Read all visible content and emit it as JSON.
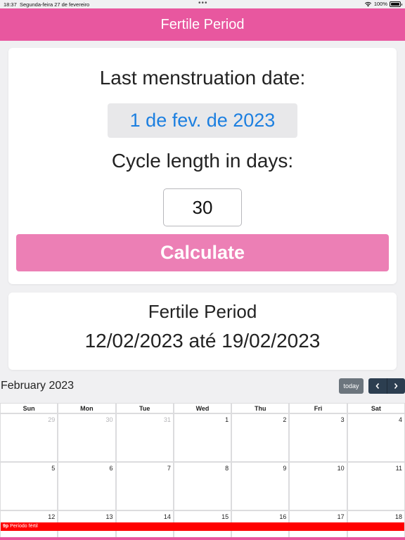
{
  "status_bar": {
    "time": "18:37",
    "date": "Segunda-feira 27 de fevereiro",
    "dots": "•••",
    "battery": "100%"
  },
  "header": {
    "title": "Fertile Period"
  },
  "form": {
    "last_menstruation_label": "Last menstruation date:",
    "date_value": "1 de fev. de 2023",
    "cycle_label": "Cycle length in days:",
    "cycle_value": "30",
    "calculate_label": "Calculate"
  },
  "result": {
    "title": "Fertile Period",
    "range": "12/02/2023 até 19/02/2023"
  },
  "calendar": {
    "title": "February 2023",
    "today_label": "today",
    "prev_icon": "chevron-left-icon",
    "next_icon": "chevron-right-icon",
    "weekdays": [
      "Sun",
      "Mon",
      "Tue",
      "Wed",
      "Thu",
      "Fri",
      "Sat"
    ],
    "weeks": [
      [
        {
          "day": "29",
          "other": true
        },
        {
          "day": "30",
          "other": true
        },
        {
          "day": "31",
          "other": true
        },
        {
          "day": "1",
          "other": false
        },
        {
          "day": "2",
          "other": false
        },
        {
          "day": "3",
          "other": false
        },
        {
          "day": "4",
          "other": false
        }
      ],
      [
        {
          "day": "5",
          "other": false
        },
        {
          "day": "6",
          "other": false
        },
        {
          "day": "7",
          "other": false
        },
        {
          "day": "8",
          "other": false
        },
        {
          "day": "9",
          "other": false
        },
        {
          "day": "10",
          "other": false
        },
        {
          "day": "11",
          "other": false
        }
      ],
      [
        {
          "day": "12",
          "other": false
        },
        {
          "day": "13",
          "other": false
        },
        {
          "day": "14",
          "other": false
        },
        {
          "day": "15",
          "other": false
        },
        {
          "day": "16",
          "other": false
        },
        {
          "day": "17",
          "other": false
        },
        {
          "day": "18",
          "other": false
        }
      ]
    ],
    "event": {
      "time": "9p",
      "title": "Período fértil"
    }
  },
  "colors": {
    "header": "#e8579f",
    "calculate_button": "#ec7fb5",
    "date_text": "#1c7fe0",
    "event": "#ff0000",
    "nav_buttons": "#2c3e50",
    "today_button": "#6c757d"
  }
}
